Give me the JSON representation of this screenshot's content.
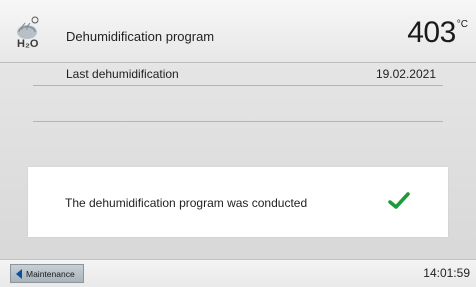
{
  "header": {
    "icon": "dehumidification-icon",
    "icon_text": "H₂O",
    "title": "Dehumidification program",
    "temperature": "403",
    "temperature_unit": "°C"
  },
  "content": {
    "last_dehumidification": {
      "label": "Last dehumidification",
      "value": "19.02.2021"
    }
  },
  "message": {
    "text": "The dehumidification program was conducted",
    "status_icon": "checkmark-icon",
    "status_color": "#1f9a3b"
  },
  "footer": {
    "back_label": "Maintenance",
    "back_icon": "arrow-left-icon",
    "time": "14:01:59"
  },
  "colors": {
    "accent": "#0b4f9c",
    "success": "#1f9a3b"
  }
}
